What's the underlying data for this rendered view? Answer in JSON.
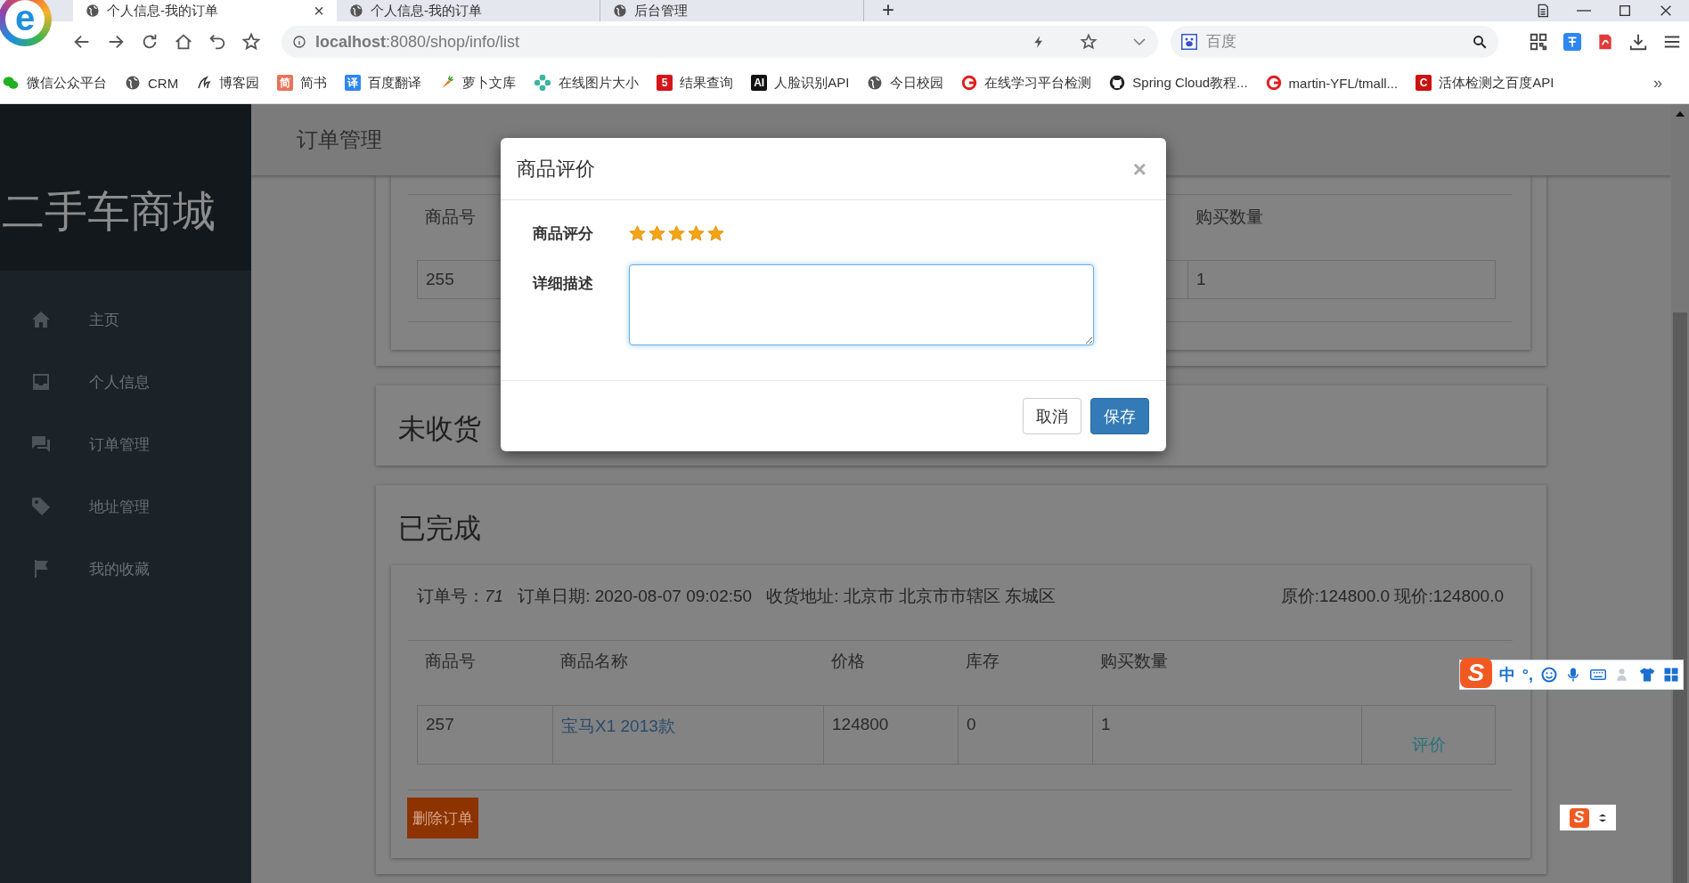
{
  "browser": {
    "logo": "e",
    "tabs": [
      {
        "title": "个人信息-我的订单",
        "selected": true,
        "close": "×"
      },
      {
        "title": "个人信息-我的订单",
        "selected": false
      },
      {
        "title": "后台管理",
        "selected": false
      }
    ],
    "new_tab": "+",
    "url": "**localhost**:8080/shop/info/list",
    "search": {
      "placeholder": "百度"
    },
    "bookmarks": [
      {
        "label": "微信公众平台",
        "kind": "wechat"
      },
      {
        "label": "CRM",
        "kind": "globe"
      },
      {
        "label": "博客园",
        "kind": "cnblogs"
      },
      {
        "label": "简书",
        "kind": "badge",
        "badge": "简",
        "color": "#e9735a"
      },
      {
        "label": "百度翻译",
        "kind": "badge",
        "badge": "译",
        "color": "#2e86f0"
      },
      {
        "label": "萝卜文库",
        "kind": "carrot"
      },
      {
        "label": "在线图片大小",
        "kind": "flower"
      },
      {
        "label": "结果查询",
        "kind": "badge",
        "badge": "5",
        "color": "#d7141a"
      },
      {
        "label": "人脸识别API",
        "kind": "badge",
        "badge": "AI",
        "color": "#111111"
      },
      {
        "label": "今日校园",
        "kind": "globe"
      },
      {
        "label": "在线学习平台检测",
        "kind": "ring"
      },
      {
        "label": "Spring Cloud教程...",
        "kind": "github"
      },
      {
        "label": "martin-YFL/tmall...",
        "kind": "ring"
      },
      {
        "label": "活体检测之百度API",
        "kind": "badge",
        "badge": "C",
        "color": "#cc1111"
      }
    ],
    "more": "»"
  },
  "sidebar": {
    "title": "二手车商城",
    "items": [
      {
        "label": "主页",
        "kind": "home"
      },
      {
        "label": "个人信息",
        "kind": "inbox"
      },
      {
        "label": "订单管理",
        "kind": "chat"
      },
      {
        "label": "地址管理",
        "kind": "tag"
      },
      {
        "label": "我的收藏",
        "kind": "flag"
      }
    ]
  },
  "header": {
    "title": "订单管理"
  },
  "partial_order": {
    "columns": [
      "商品号",
      "购买数量"
    ],
    "row": [
      "255",
      "1"
    ]
  },
  "sections": [
    {
      "title": "未收货"
    },
    {
      "title": "已完成",
      "orders": [
        {
          "order_no": "订单号：*71*",
          "date": "订单日期: 2020-08-07 09:02:50",
          "address": "收货地址: 北京市 北京市市辖区 东城区",
          "price": "原价:124800.0 现价:124800.0",
          "columns": [
            "商品号",
            "商品名称",
            "价格",
            "库存",
            "购买数量"
          ],
          "items": [
            {
              "id": "257",
              "name": "宝马X1 2013款",
              "price": "124800",
              "stock": "0",
              "quantity": "1",
              "action": "评价"
            }
          ],
          "delete": "删除订单"
        }
      ]
    }
  ],
  "modal": {
    "title": "商品评价",
    "close": "×",
    "rating_label": "商品评分",
    "stars": 5,
    "description_label": "详细描述",
    "buttons": [
      {
        "label": "取消",
        "kind": "default"
      },
      {
        "label": "保存",
        "kind": "primary"
      }
    ]
  },
  "ime_toolbar": {
    "logo": "S",
    "mode": "中",
    "punctuation": "°,"
  },
  "ime_status": {
    "logo": "S"
  }
}
